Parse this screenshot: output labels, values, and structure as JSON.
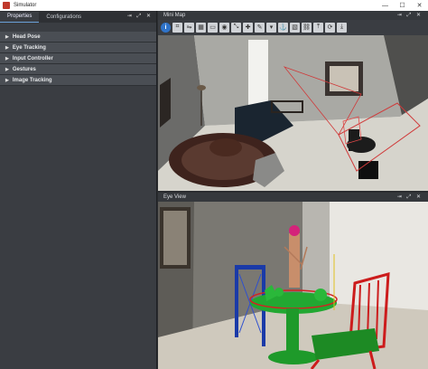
{
  "window": {
    "title": "Simulator",
    "minimize": "—",
    "maximize": "☐",
    "close": "✕"
  },
  "left_panel": {
    "tabs": [
      "Properties",
      "Configurations"
    ],
    "controls": "⇥ ⤢ ✕",
    "sections": [
      "Head Pose",
      "Eye Tracking",
      "Input Controller",
      "Gestures",
      "Image Tracking"
    ]
  },
  "mini_map": {
    "title": "Mini Map",
    "controls": "⇥ ⤢ ✕",
    "toolbar_icons": [
      "info-icon",
      "crop-icon",
      "flip-icon",
      "grid-icon",
      "monitor-icon",
      "camera-icon",
      "resize-icon",
      "pin-icon",
      "edit-icon",
      "chevron-down-icon",
      "anchor-icon",
      "pattern-icon",
      "link-icon",
      "upload-icon",
      "sync-icon",
      "download-icon"
    ],
    "toolbar_glyphs": [
      "i",
      "⌗",
      "⇋",
      "▦",
      "▭",
      "◉",
      "⤡",
      "✚",
      "✎",
      "▾",
      "⚓",
      "▧",
      "⛓",
      "⤒",
      "⟳",
      "⤓"
    ]
  },
  "eye_view": {
    "title": "Eye View",
    "controls": "⇥ ⤢ ✕"
  }
}
